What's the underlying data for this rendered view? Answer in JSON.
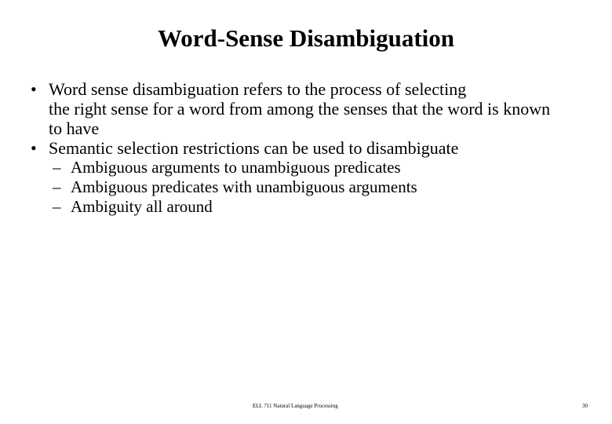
{
  "slide": {
    "title": "Word-Sense Disambiguation",
    "background_color": "#ffffff",
    "text_color": "#000000"
  },
  "content": {
    "bullets": [
      {
        "level": 1,
        "marker": "•",
        "lines": [
          "Word sense disambiguation refers to the process of selecting",
          "the right sense for a word from among the senses that the word is known",
          "to have"
        ],
        "text": "Word sense disambiguation refers to the process of selecting the right sense for a word from among the senses that the word is known to have"
      },
      {
        "level": 1,
        "marker": "•",
        "lines": [
          "Semantic selection restrictions can be used to disambiguate"
        ],
        "text": "Semantic selection restrictions can be used to disambiguate"
      },
      {
        "level": 2,
        "marker": "–",
        "lines": [
          "Ambiguous arguments to unambiguous predicates"
        ],
        "text": "Ambiguous arguments to unambiguous predicates"
      },
      {
        "level": 2,
        "marker": "–",
        "lines": [
          "Ambiguous predicates with unambiguous arguments"
        ],
        "text": "Ambiguous predicates with unambiguous arguments"
      },
      {
        "level": 2,
        "marker": "–",
        "lines": [
          "Ambiguity all around"
        ],
        "text": "Ambiguity all around"
      }
    ]
  },
  "footer": {
    "course": "ELL 711 Natural Language Processing",
    "page_number": "30"
  }
}
